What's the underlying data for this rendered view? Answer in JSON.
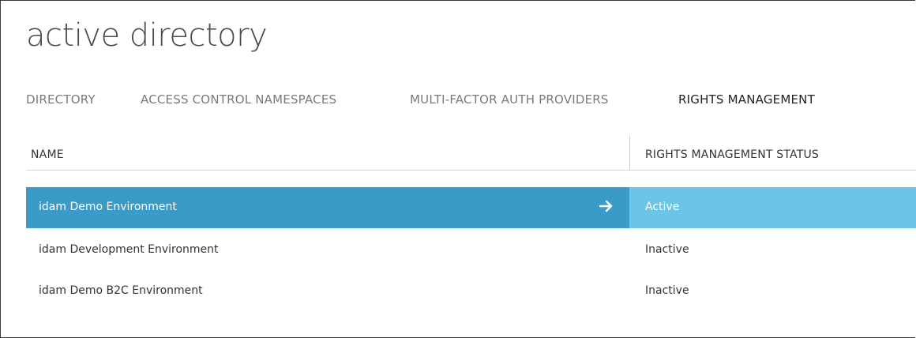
{
  "page": {
    "title": "active directory"
  },
  "tabs": [
    {
      "label": "DIRECTORY",
      "active": false
    },
    {
      "label": "ACCESS CONTROL NAMESPACES",
      "active": false
    },
    {
      "label": "MULTI-FACTOR AUTH PROVIDERS",
      "active": false
    },
    {
      "label": "RIGHTS MANAGEMENT",
      "active": true
    }
  ],
  "table": {
    "columns": [
      "NAME",
      "RIGHTS MANAGEMENT STATUS"
    ],
    "rows": [
      {
        "name": "idam Demo Environment",
        "status": "Active",
        "selected": true,
        "icon": "arrow-right-icon"
      },
      {
        "name": "idam Development Environment",
        "status": "Inactive",
        "selected": false
      },
      {
        "name": "idam Demo B2C Environment",
        "status": "Inactive",
        "selected": false
      }
    ]
  },
  "colors": {
    "selected_row": "#3a9bc8",
    "selected_status": "#6ac5e6",
    "text": "#333333",
    "tab_inactive": "#7a7a7a"
  }
}
